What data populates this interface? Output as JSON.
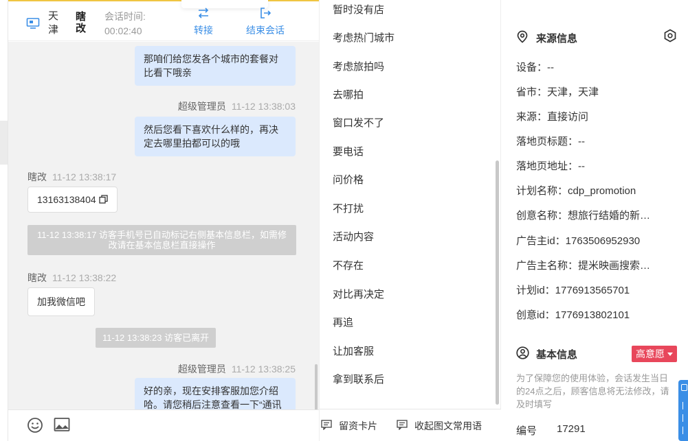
{
  "header": {
    "city": "天津",
    "visitor_name": "瞎改",
    "session_label": "会话时间:",
    "session_time": "00:02:40",
    "transfer_label": "转接",
    "end_label": "结束会话"
  },
  "messages": {
    "m1": "那咱们给您发各个城市的套餐对比看下哦亲",
    "m2_sender": "超级管理员",
    "m2_time": "11-12 13:38:03",
    "m2_text": "然后您看下喜欢什么样的，再决定去哪里拍都可以的哦",
    "m3_sender": "瞎改",
    "m3_time": "11-12 13:38:17",
    "m3_text": "13163138404",
    "sys1": "11-12 13:38:17 访客手机号已自动标记右侧基本信息栏，如需修改请在基本信息栏直接操作",
    "m4_sender": "瞎改",
    "m4_time": "11-12 13:38:22",
    "m4_text": "加我微信吧",
    "sys2": "11-12 13:38:23 访客已离开",
    "m5_sender": "超级管理员",
    "m5_time": "11-12 13:38:25",
    "m5_text": "好的亲，现在安排客服加您介绍哈。请您稍后注意查看一下“通讯"
  },
  "quick_replies": [
    "暂时没有店",
    "考虑热门城市",
    "考虑旅拍吗",
    "去哪拍",
    "窗口发不了",
    "要电话",
    "问价格",
    "不打扰",
    "活动内容",
    "不存在",
    "对比再决定",
    "再追",
    "让加客服",
    "拿到联系后"
  ],
  "replies_footer": {
    "card_label": "留资卡片",
    "collect_label": "收起图文常用语"
  },
  "source_info": {
    "title": "来源信息",
    "fields": [
      "设备：--",
      "省市：天津，天津",
      "来源：直接访问",
      "落地页标题：--",
      "落地页地址：--",
      "计划名称：cdp_promotion",
      "创意名称：想旅行结婚的新人们看过来",
      "广告主id：1763506952930",
      "广告主名称：提米映画搜索推广",
      "计划id：1776913565701",
      "创意id：1776913802101"
    ]
  },
  "basic_info": {
    "title": "基本信息",
    "badge": "高意愿",
    "note": "为了保障您的使用体验，会话发生当日的24点之后，顾客信息将无法修改，请及时填写",
    "number_label": "编号",
    "number_value": "17291"
  },
  "colors": {
    "accent": "#3a8ee6",
    "bubble_agent": "#dbe9fd",
    "badge": "#e8475b",
    "top_line": "#f0c542"
  }
}
